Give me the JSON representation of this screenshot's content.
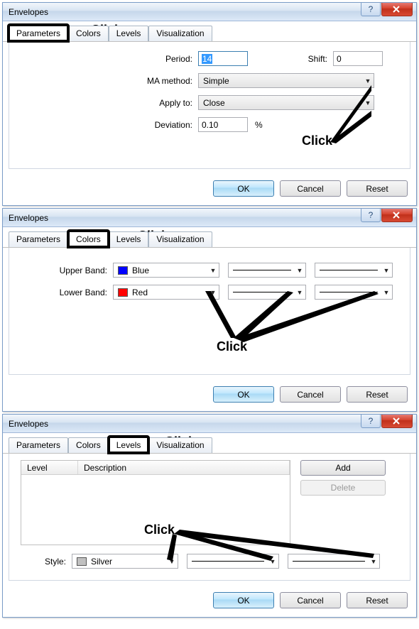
{
  "dialog_title": "Envelopes",
  "tabs": {
    "parameters": "Parameters",
    "colors": "Colors",
    "levels": "Levels",
    "visualization": "Visualization"
  },
  "buttons": {
    "ok": "OK",
    "cancel": "Cancel",
    "reset": "Reset",
    "add": "Add",
    "delete": "Delete"
  },
  "annotations": {
    "click": "Click"
  },
  "params": {
    "period_label": "Period:",
    "period_value": "14",
    "shift_label": "Shift:",
    "shift_value": "0",
    "ma_label": "MA method:",
    "ma_value": "Simple",
    "apply_label": "Apply to:",
    "apply_value": "Close",
    "dev_label": "Deviation:",
    "dev_value": "0.10",
    "dev_unit": "%"
  },
  "colors": {
    "upper_label": "Upper Band:",
    "upper_value": "Blue",
    "upper_hex": "#0000ff",
    "lower_label": "Lower Band:",
    "lower_value": "Red",
    "lower_hex": "#ff0000"
  },
  "levels": {
    "col_level": "Level",
    "col_desc": "Description",
    "style_label": "Style:",
    "style_value": "Silver",
    "style_hex": "#c0c0c0"
  }
}
